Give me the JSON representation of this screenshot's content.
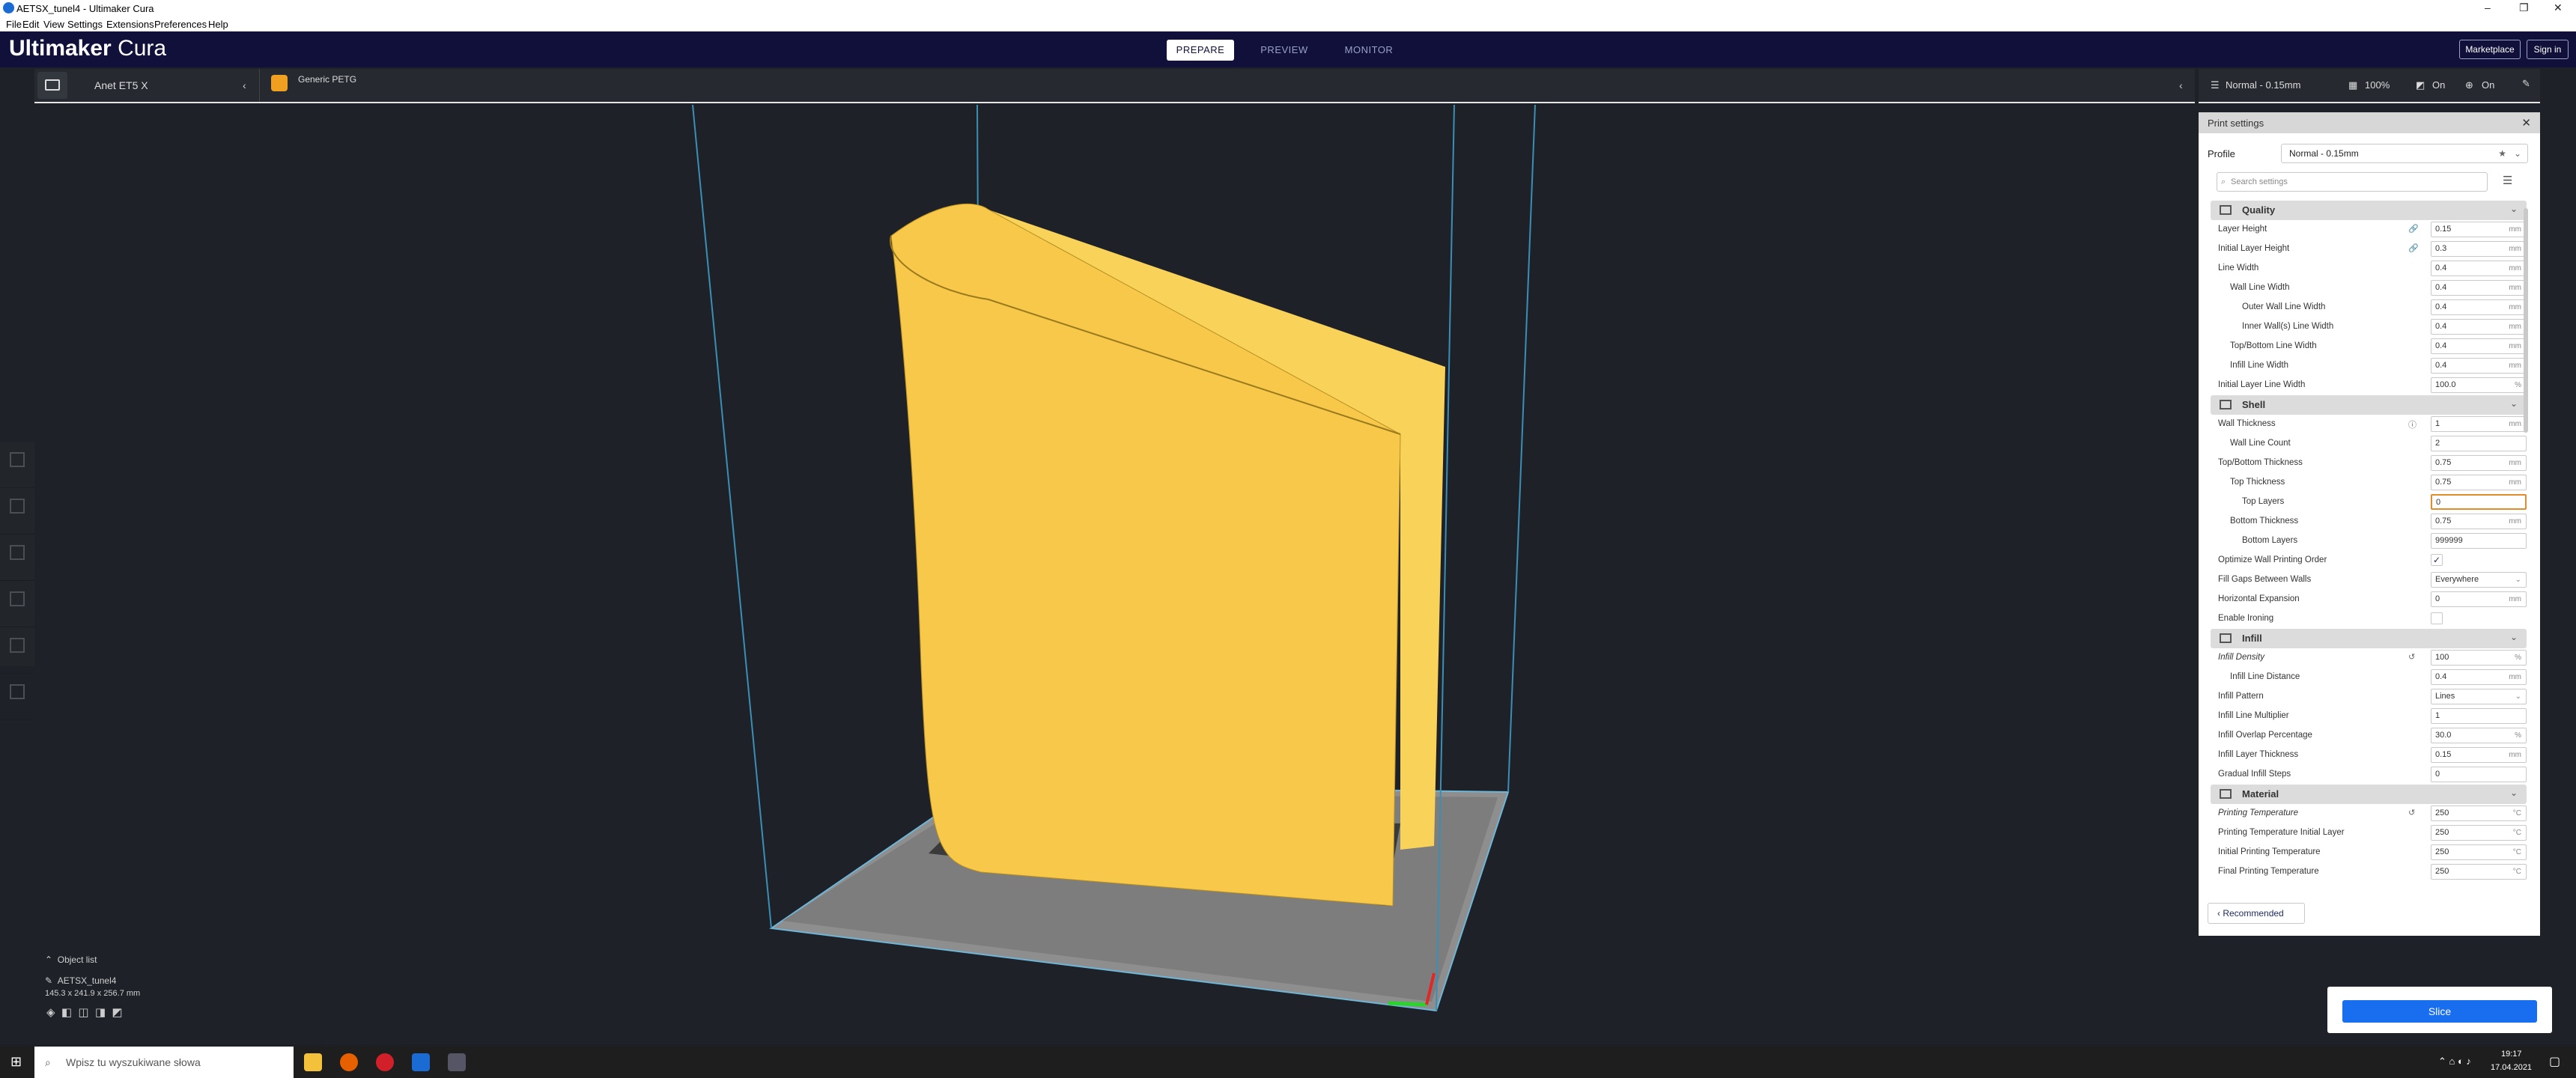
{
  "window": {
    "title": "AETSX_tunel4 - Ultimaker Cura",
    "controls": [
      "–",
      "❐",
      "✕"
    ]
  },
  "menu": [
    "File",
    "Edit",
    "View",
    "Settings",
    "Extensions",
    "Preferences",
    "Help"
  ],
  "header": {
    "logo_bold": "Ultimaker",
    "logo_light": " Cura",
    "tabs": [
      "PREPARE",
      "PREVIEW",
      "MONITOR"
    ],
    "marketplace": "Marketplace",
    "signin": "Sign in"
  },
  "printer_bar": {
    "printer": "Anet ET5 X",
    "material": "Generic PETG",
    "profile": "Normal - 0.15mm",
    "infill": "100%",
    "support": "On",
    "adhesion": "On"
  },
  "panel": {
    "title": "Print settings",
    "profile_label": "Profile",
    "profile_value": "Normal - 0.15mm",
    "search_placeholder": "Search settings",
    "recommended_button": "Recommended"
  },
  "settings": [
    {
      "type": "cat",
      "label": "Quality"
    },
    {
      "type": "row",
      "label": "Layer Height",
      "indent": 0,
      "value": "0.15",
      "unit": "mm",
      "icon": "link"
    },
    {
      "type": "row",
      "label": "Initial Layer Height",
      "indent": 0,
      "value": "0.3",
      "unit": "mm",
      "icon": "link"
    },
    {
      "type": "row",
      "label": "Line Width",
      "indent": 0,
      "value": "0.4",
      "unit": "mm"
    },
    {
      "type": "row",
      "label": "Wall Line Width",
      "indent": 1,
      "value": "0.4",
      "unit": "mm"
    },
    {
      "type": "row",
      "label": "Outer Wall Line Width",
      "indent": 2,
      "value": "0.4",
      "unit": "mm"
    },
    {
      "type": "row",
      "label": "Inner Wall(s) Line Width",
      "indent": 2,
      "value": "0.4",
      "unit": "mm"
    },
    {
      "type": "row",
      "label": "Top/Bottom Line Width",
      "indent": 1,
      "value": "0.4",
      "unit": "mm"
    },
    {
      "type": "row",
      "label": "Infill Line Width",
      "indent": 1,
      "value": "0.4",
      "unit": "mm"
    },
    {
      "type": "row",
      "label": "Initial Layer Line Width",
      "indent": 0,
      "value": "100.0",
      "unit": "%"
    },
    {
      "type": "cat",
      "label": "Shell"
    },
    {
      "type": "row",
      "label": "Wall Thickness",
      "indent": 0,
      "value": "1",
      "unit": "mm",
      "icon": "info"
    },
    {
      "type": "row",
      "label": "Wall Line Count",
      "indent": 1,
      "value": "2",
      "unit": ""
    },
    {
      "type": "row",
      "label": "Top/Bottom Thickness",
      "indent": 0,
      "value": "0.75",
      "unit": "mm"
    },
    {
      "type": "row",
      "label": "Top Thickness",
      "indent": 1,
      "value": "0.75",
      "unit": "mm"
    },
    {
      "type": "row",
      "label": "Top Layers",
      "indent": 2,
      "value": "0",
      "unit": "",
      "highlight": true
    },
    {
      "type": "row",
      "label": "Bottom Thickness",
      "indent": 1,
      "value": "0.75",
      "unit": "mm"
    },
    {
      "type": "row",
      "label": "Bottom Layers",
      "indent": 2,
      "value": "999999",
      "unit": ""
    },
    {
      "type": "check",
      "label": "Optimize Wall Printing Order",
      "indent": 0,
      "checked": true
    },
    {
      "type": "row",
      "label": "Fill Gaps Between Walls",
      "indent": 0,
      "value": "Everywhere",
      "unit": "⌄"
    },
    {
      "type": "row",
      "label": "Horizontal Expansion",
      "indent": 0,
      "value": "0",
      "unit": "mm"
    },
    {
      "type": "check",
      "label": "Enable Ironing",
      "indent": 0,
      "checked": false
    },
    {
      "type": "cat",
      "label": "Infill"
    },
    {
      "type": "row",
      "label": "Infill Density",
      "indent": 0,
      "value": "100",
      "unit": "%",
      "icon": "reset",
      "italic": true
    },
    {
      "type": "row",
      "label": "Infill Line Distance",
      "indent": 1,
      "value": "0.4",
      "unit": "mm"
    },
    {
      "type": "row",
      "label": "Infill Pattern",
      "indent": 0,
      "value": "Lines",
      "unit": "⌄"
    },
    {
      "type": "row",
      "label": "Infill Line Multiplier",
      "indent": 0,
      "value": "1",
      "unit": ""
    },
    {
      "type": "row",
      "label": "Infill Overlap Percentage",
      "indent": 0,
      "value": "30.0",
      "unit": "%"
    },
    {
      "type": "row",
      "label": "Infill Layer Thickness",
      "indent": 0,
      "value": "0.15",
      "unit": "mm"
    },
    {
      "type": "row",
      "label": "Gradual Infill Steps",
      "indent": 0,
      "value": "0",
      "unit": ""
    },
    {
      "type": "cat",
      "label": "Material"
    },
    {
      "type": "row",
      "label": "Printing Temperature",
      "indent": 0,
      "value": "250",
      "unit": "°C",
      "icon": "reset",
      "italic": true
    },
    {
      "type": "row",
      "label": "Printing Temperature Initial Layer",
      "indent": 0,
      "value": "250",
      "unit": "°C"
    },
    {
      "type": "row",
      "label": "Initial Printing Temperature",
      "indent": 0,
      "value": "250",
      "unit": "°C"
    },
    {
      "type": "row",
      "label": "Final Printing Temperature",
      "indent": 0,
      "value": "250",
      "unit": "°C"
    }
  ],
  "object_list": {
    "title": "Object list",
    "name": "AETSX_tunel4",
    "dims": "145.3 x 241.9 x 256.7 mm"
  },
  "slice": {
    "button": "Slice"
  },
  "taskbar": {
    "search": "Wpisz tu wyszukiwane słowa",
    "time": "19:17",
    "date": "17.04.2021"
  },
  "colors": {
    "header": "#10103a",
    "model": "#f7c84a",
    "accent": "#196ef0"
  }
}
